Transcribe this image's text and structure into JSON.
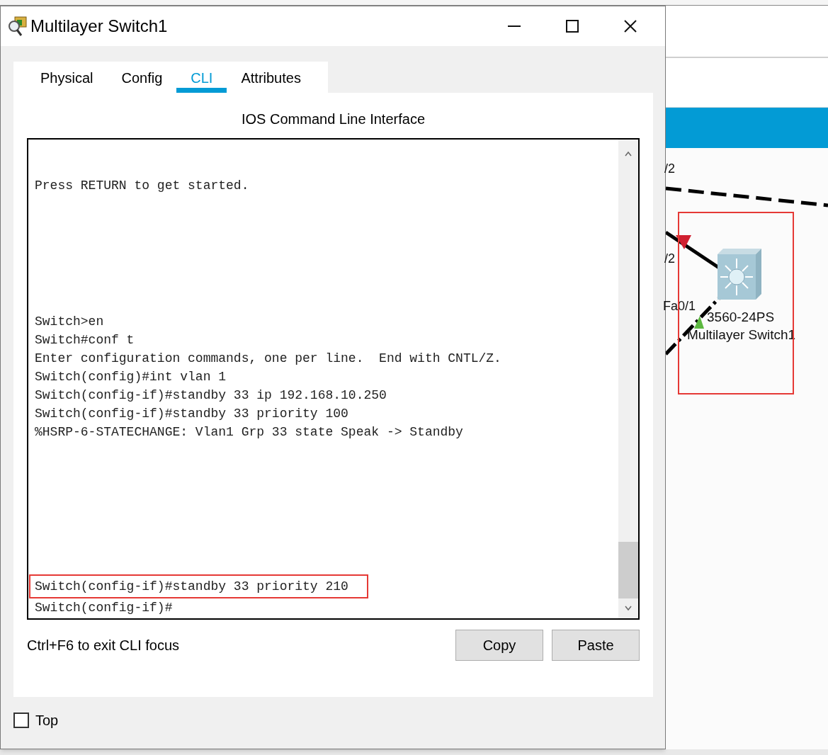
{
  "window": {
    "title": "Multilayer Switch1"
  },
  "tabs": [
    {
      "label": "Physical",
      "selected": false
    },
    {
      "label": "Config",
      "selected": false
    },
    {
      "label": "CLI",
      "selected": true
    },
    {
      "label": "Attributes",
      "selected": false
    }
  ],
  "panel_title": "IOS Command Line Interface",
  "terminal": {
    "blocks": [
      [
        {
          "text": "Press RETURN to get started.",
          "highlighted": false
        }
      ],
      [
        {
          "text": "Switch>en",
          "highlighted": false
        },
        {
          "text": "Switch#conf t",
          "highlighted": false
        },
        {
          "text": "Enter configuration commands, one per line.  End with CNTL/Z.",
          "highlighted": false
        },
        {
          "text": "Switch(config)#int vlan 1",
          "highlighted": false
        },
        {
          "text": "Switch(config-if)#standby 33 ip 192.168.10.250",
          "highlighted": false
        },
        {
          "text": "Switch(config-if)#standby 33 priority 100",
          "highlighted": false
        },
        {
          "text": "%HSRP-6-STATECHANGE: Vlan1 Grp 33 state Speak -> Standby",
          "highlighted": false
        }
      ],
      [
        {
          "text": "Switch(config-if)#standby 33 priority 210",
          "highlighted": true
        },
        {
          "text": "Switch(config-if)#",
          "highlighted": false
        }
      ]
    ]
  },
  "hint": "Ctrl+F6 to exit CLI focus",
  "buttons": [
    "Copy",
    "Paste"
  ],
  "top_checkbox": {
    "label": "Top",
    "checked": false
  },
  "canvas": {
    "labels": [
      {
        "kind": "port",
        "text": "/2"
      },
      {
        "kind": "port",
        "text": "/2"
      },
      {
        "kind": "port",
        "text": "Fa0/1"
      },
      {
        "kind": "device",
        "text": "3560-24PS"
      },
      {
        "kind": "device",
        "text": "Multilayer Switch1"
      }
    ],
    "highlighted": true
  }
}
